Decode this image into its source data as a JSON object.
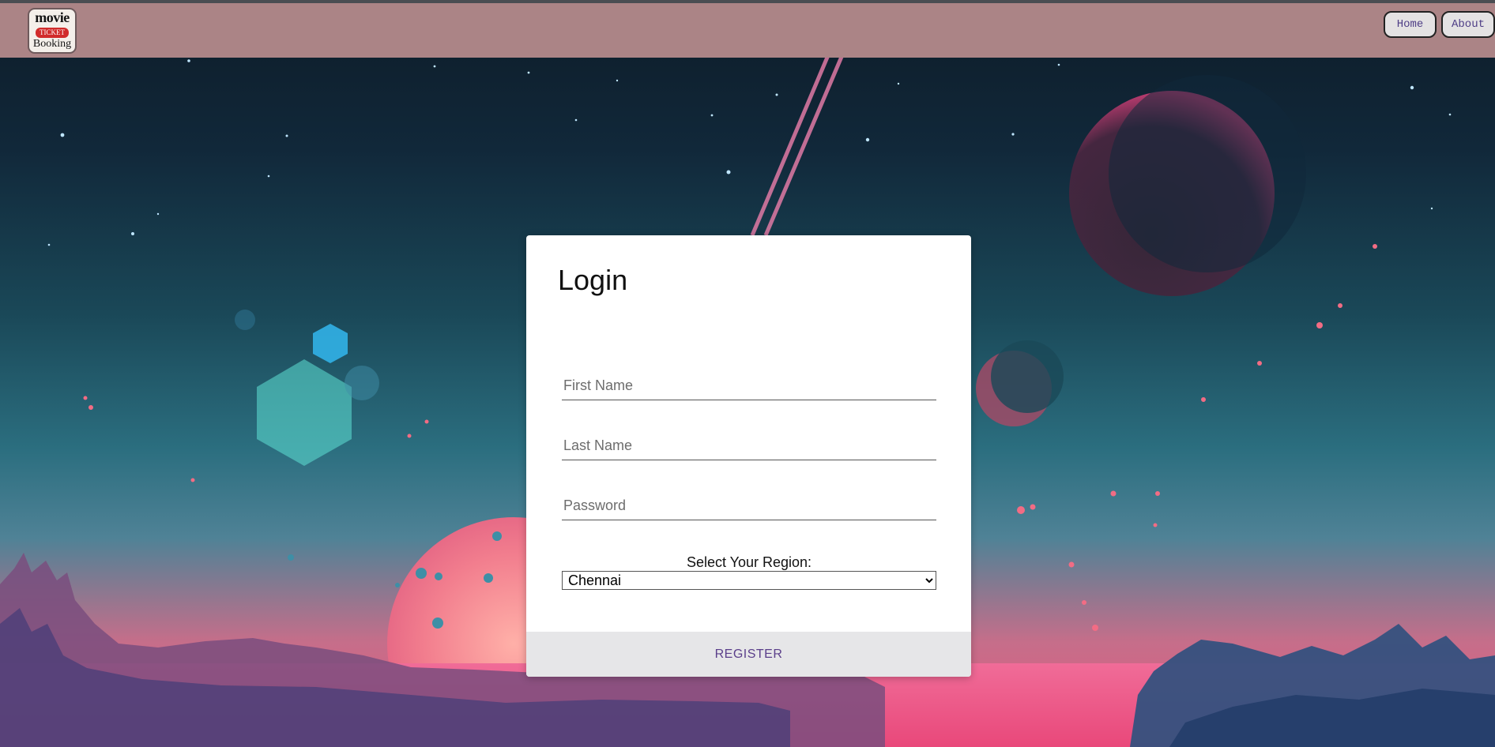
{
  "header": {
    "logo": {
      "line1": "movie",
      "ticket": "TICKET",
      "line3": "Booking"
    },
    "nav": {
      "home": "Home",
      "about": "About"
    }
  },
  "card": {
    "title": "Login",
    "fields": {
      "first_name": {
        "placeholder": "First Name",
        "value": ""
      },
      "last_name": {
        "placeholder": "Last Name",
        "value": ""
      },
      "password": {
        "placeholder": "Password",
        "value": ""
      }
    },
    "region": {
      "label": "Select Your Region:",
      "selected": "Chennai"
    },
    "register_label": "REGISTER"
  },
  "colors": {
    "topbar": "#ab8486",
    "register_text": "#5a3e8a",
    "nav_text": "#4e3d86",
    "card_footer": "#e6e6e8"
  }
}
